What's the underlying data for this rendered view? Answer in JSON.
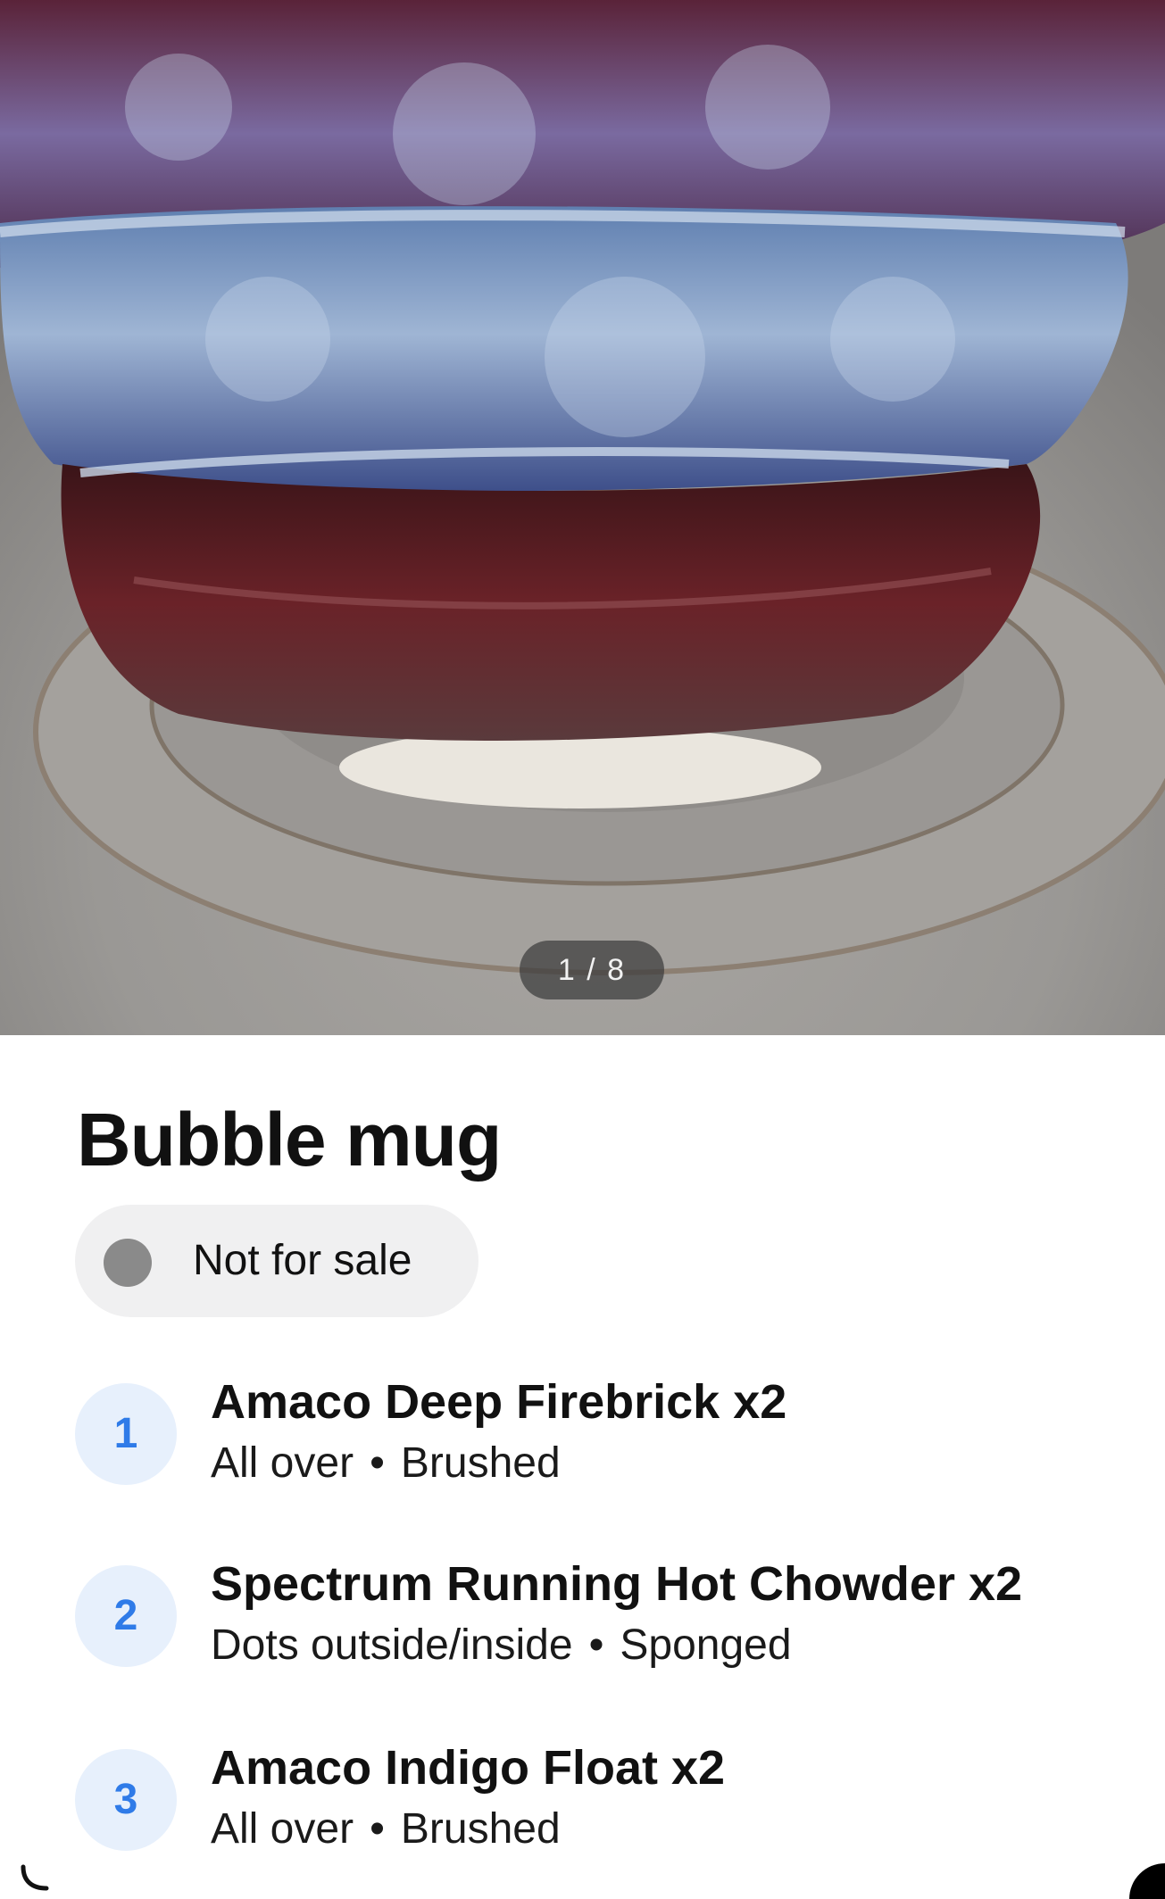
{
  "photo": {
    "counter": "1 / 8"
  },
  "piece": {
    "title": "Bubble mug",
    "status": {
      "label": "Not for sale",
      "color": "#8a8a8a"
    }
  },
  "glazes": [
    {
      "number": "1",
      "name": "Amaco Deep Firebrick x2",
      "area": "All over",
      "method": "Brushed"
    },
    {
      "number": "2",
      "name": "Spectrum Running Hot Chowder x2",
      "area": "Dots outside/inside",
      "method": "Sponged"
    },
    {
      "number": "3",
      "name": "Amaco Indigo Float x2",
      "area": "All over",
      "method": "Brushed"
    }
  ],
  "separator": "•",
  "colors": {
    "accent": "#2f7be8",
    "number_bg": "#e7f0fc",
    "pill_bg": "#f0f0f1"
  }
}
